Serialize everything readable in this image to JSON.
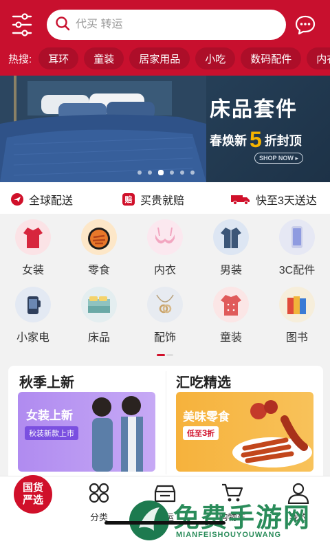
{
  "header": {
    "search_placeholder": "代买 转运",
    "hot_label": "热搜:",
    "hot_tags": [
      "耳环",
      "童装",
      "居家用品",
      "小吃",
      "数码配件",
      "内衣"
    ]
  },
  "banner": {
    "title": "床品套件",
    "sub_prefix": "春焕新",
    "sub_number": "5",
    "sub_suffix": "折封顶",
    "cta": "SHOP NOW ▸",
    "slide_count": 6,
    "active_slide": 3
  },
  "guarantees": [
    {
      "label": "全球配送",
      "icon": "plane-icon"
    },
    {
      "label": "买贵就赔",
      "icon": "compensation-icon",
      "glyph": "赔"
    },
    {
      "label": "快至3天送达",
      "icon": "truck-icon"
    }
  ],
  "categories": [
    {
      "label": "女装",
      "icon": "womens-clothing-icon"
    },
    {
      "label": "零食",
      "icon": "snacks-icon"
    },
    {
      "label": "内衣",
      "icon": "underwear-icon"
    },
    {
      "label": "男装",
      "icon": "mens-clothing-icon"
    },
    {
      "label": "3C配件",
      "icon": "phone-accessory-icon"
    },
    {
      "label": "小家电",
      "icon": "small-appliance-icon"
    },
    {
      "label": "床品",
      "icon": "bedding-icon"
    },
    {
      "label": "配饰",
      "icon": "accessory-icon"
    },
    {
      "label": "童装",
      "icon": "kids-clothing-icon"
    },
    {
      "label": "图书",
      "icon": "books-icon"
    }
  ],
  "promos": [
    {
      "title": "秋季上新",
      "tag": "女装上新",
      "sub": "秋装新款上市"
    },
    {
      "title": "汇吃精选",
      "tag": "美味零食",
      "sub_prefix": "低至",
      "sub_number": "3",
      "sub_suffix": "折"
    }
  ],
  "tabbar": {
    "home": "国货\n严选",
    "home_line1": "国货",
    "home_line2": "严选",
    "category": "分类",
    "shipping": "转运",
    "cart": "购物车",
    "mine": "我的"
  },
  "watermark": {
    "text": "免费手游网",
    "sub": "MIANFEISHOUYOUWANG"
  },
  "colors": {
    "brand_red": "#c8102e",
    "banner_blue": "#243d55",
    "accent_yellow": "#f5b400"
  }
}
